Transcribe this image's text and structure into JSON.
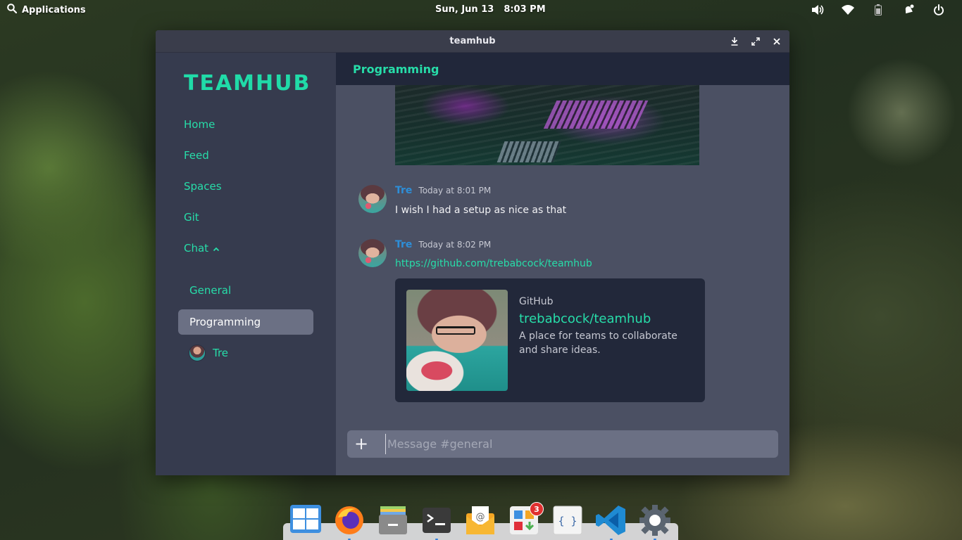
{
  "top_panel": {
    "applications_label": "Applications",
    "date": "Sun, Jun 13",
    "time": "8:03 PM",
    "indicators": [
      "volume-icon",
      "wifi-icon",
      "battery-icon",
      "notifications-icon",
      "power-icon"
    ]
  },
  "window": {
    "title": "teamhub",
    "controls": [
      "download-icon",
      "maximize-icon",
      "close-icon"
    ]
  },
  "sidebar": {
    "brand": "TEAMHUB",
    "nav": [
      {
        "label": "Home"
      },
      {
        "label": "Feed"
      },
      {
        "label": "Spaces"
      },
      {
        "label": "Git"
      },
      {
        "label": "Chat"
      }
    ],
    "chat_items": [
      {
        "label": "General"
      },
      {
        "label": "Programming",
        "active": true
      },
      {
        "label": "Tre"
      }
    ]
  },
  "channel": {
    "title": "Programming"
  },
  "messages": [
    {
      "author": "Tre",
      "time": "Today at 8:01 PM",
      "text": "I wish I had a setup as nice as that"
    },
    {
      "author": "Tre",
      "time": "Today at 8:02 PM",
      "link": "https://github.com/trebabcock/teamhub"
    }
  ],
  "embed": {
    "site": "GitHub",
    "title": "trebabcock/teamhub",
    "description": "A place for teams to collaborate and share ideas."
  },
  "composer": {
    "plus": "+",
    "placeholder": "Message #general"
  },
  "dock": {
    "apps": [
      "multitasking-view-icon",
      "firefox-icon",
      "files-icon",
      "terminal-icon",
      "mail-icon",
      "appcenter-icon",
      "code-icon",
      "vscode-icon",
      "settings-icon"
    ],
    "appcenter_badge": "3"
  },
  "colors": {
    "accent": "#27dda9",
    "author": "#2d8ed8",
    "sidebar_bg": "#363b4e",
    "main_bg": "#4b5063",
    "header_bg": "#21273a"
  }
}
